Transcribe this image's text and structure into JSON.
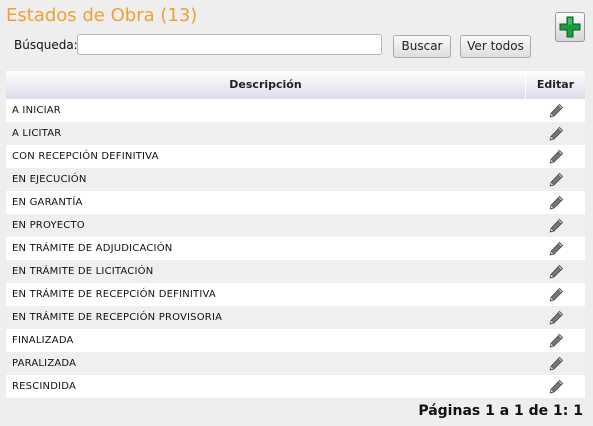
{
  "page": {
    "title": "Estados de Obra (13)",
    "add_icon": "plus-icon"
  },
  "search": {
    "label": "Búsqueda:",
    "value": "",
    "placeholder": "",
    "buscar_label": "Buscar",
    "ver_todos_label": "Ver todos"
  },
  "table": {
    "headers": {
      "descripcion": "Descripción",
      "editar": "Editar"
    },
    "edit_icon": "pencil-icon",
    "rows": [
      "A INICIAR",
      "A LICITAR",
      "CON RECEPCIÓN DEFINITIVA",
      "EN EJECUCIÓN",
      "EN GARANTÍA",
      "EN PROYECTO",
      "EN TRÁMITE DE ADJUDICACIÓN",
      "EN TRÁMITE DE LICITACIÓN",
      "EN TRÁMITE DE RECEPCIÓN DEFINITIVA",
      "EN TRÁMITE DE RECEPCIÓN PROVISORIA",
      "FINALIZADA",
      "PARALIZADA",
      "RESCINDIDA"
    ]
  },
  "pager": {
    "text": "Páginas 1 a 1 de 1: 1"
  },
  "colors": {
    "title": "#f0a030",
    "add_green": "#1f9b3f",
    "row_alt": "#efefef"
  }
}
